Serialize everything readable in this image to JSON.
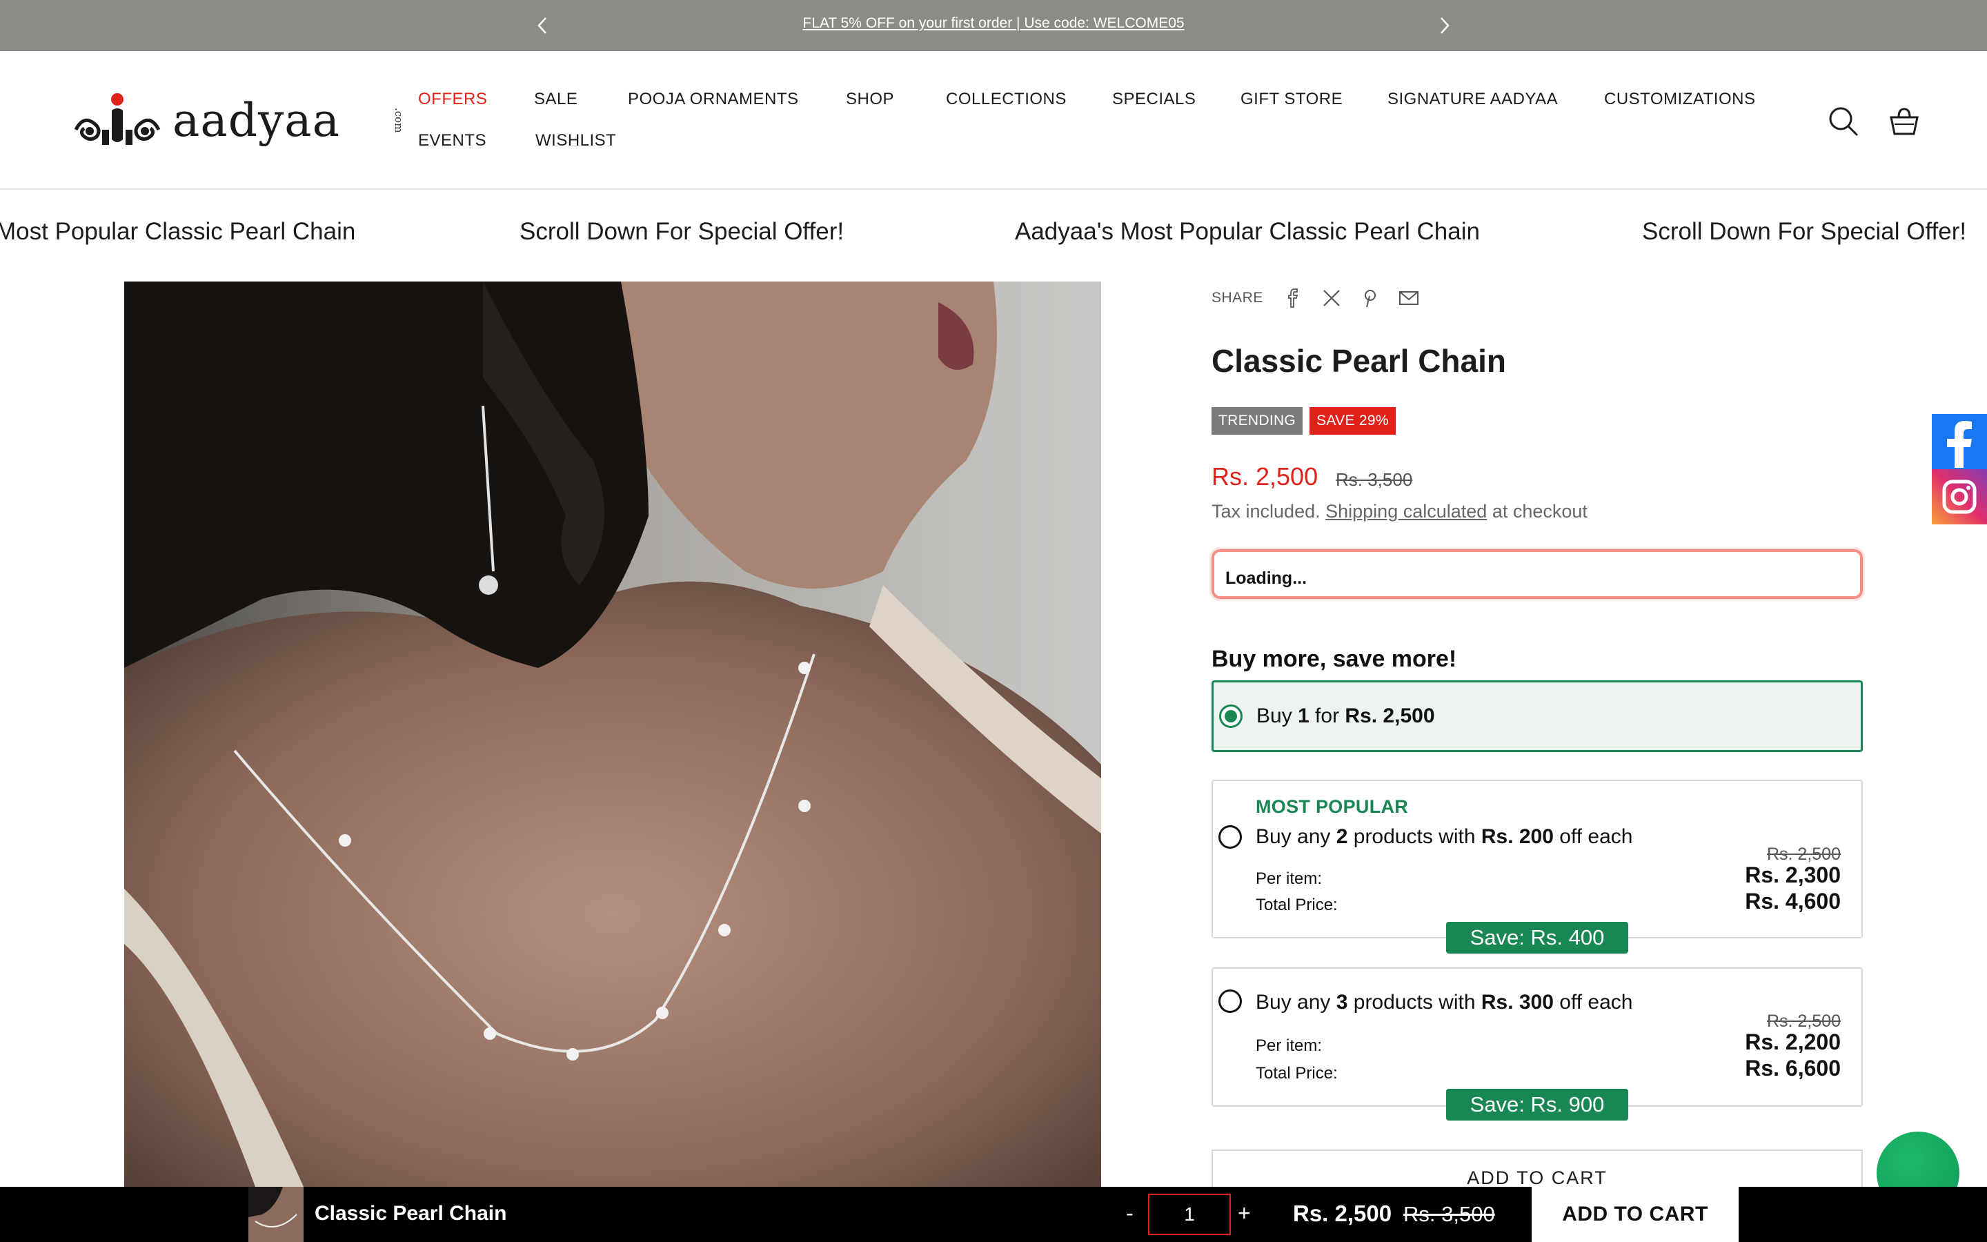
{
  "announcement": {
    "message": "FLAT 5% OFF on your first order | Use code: WELCOME05",
    "prev_icon": "chevron-left-icon",
    "next_icon": "chevron-right-icon"
  },
  "header": {
    "logo_text": "aadyaa",
    "logo_suffix": ".com",
    "nav_row1": [
      "OFFERS",
      "SALE",
      "POOJA ORNAMENTS",
      "SHOP",
      "COLLECTIONS",
      "SPECIALS",
      "GIFT STORE",
      "SIGNATURE AADYAA",
      "CUSTOMIZATIONS"
    ],
    "nav_row2": [
      "EVENTS",
      "WISHLIST"
    ],
    "search_icon": "search-icon",
    "cart_icon": "cart-icon"
  },
  "marquee": {
    "items": [
      "Most Popular Classic Pearl Chain",
      "Scroll Down For Special Offer!",
      "Aadyaa's Most Popular Classic Pearl Chain",
      "Scroll Down For Special Offer!"
    ]
  },
  "product": {
    "share_label": "SHARE",
    "share_icons": [
      "facebook-icon",
      "x-icon",
      "pinterest-icon",
      "email-icon"
    ],
    "title": "Classic Pearl Chain",
    "badge_trending": "TRENDING",
    "badge_save": "SAVE 29%",
    "price_now": "Rs. 2,500",
    "price_was": "Rs. 3,500",
    "tax_pre": "Tax included.",
    "tax_link": "Shipping calculated",
    "tax_post": "at checkout",
    "loading_text": "Loading..."
  },
  "bundles": {
    "title": "Buy more, save more!",
    "option1": {
      "pre": "Buy ",
      "qty": "1",
      "mid": " for ",
      "price": "Rs. 2,500"
    },
    "option2": {
      "tag": "MOST POPULAR",
      "pre": "Buy any ",
      "qty": "2",
      "mid": " products with ",
      "amount": "Rs. 200",
      "post": " off each",
      "per_item_label": "Per item:",
      "total_label": "Total Price:",
      "orig": "Rs. 2,500",
      "per_item": "Rs. 2,300",
      "total": "Rs. 4,600",
      "save": "Save: Rs. 400"
    },
    "option3": {
      "pre": "Buy any ",
      "qty": "3",
      "mid": " products with ",
      "amount": "Rs. 300",
      "post": " off each",
      "per_item_label": "Per item:",
      "total_label": "Total Price:",
      "orig": "Rs. 2,500",
      "per_item": "Rs. 2,200",
      "total": "Rs. 6,600",
      "save": "Save: Rs. 900"
    },
    "add_to_cart": "ADD TO CART"
  },
  "social": {
    "facebook": "facebook-icon",
    "instagram": "instagram-icon"
  },
  "sticky_bar": {
    "product_name": "Classic Pearl Chain",
    "minus": "-",
    "qty": "1",
    "plus": "+",
    "price_now": "Rs. 2,500",
    "price_was": "Rs. 3,500",
    "button": "ADD TO CART"
  },
  "colors": {
    "accent_red": "#e0221b",
    "green": "#198754",
    "announcement_bg": "#8a8d86",
    "trending_badge": "#7b7b7b"
  }
}
